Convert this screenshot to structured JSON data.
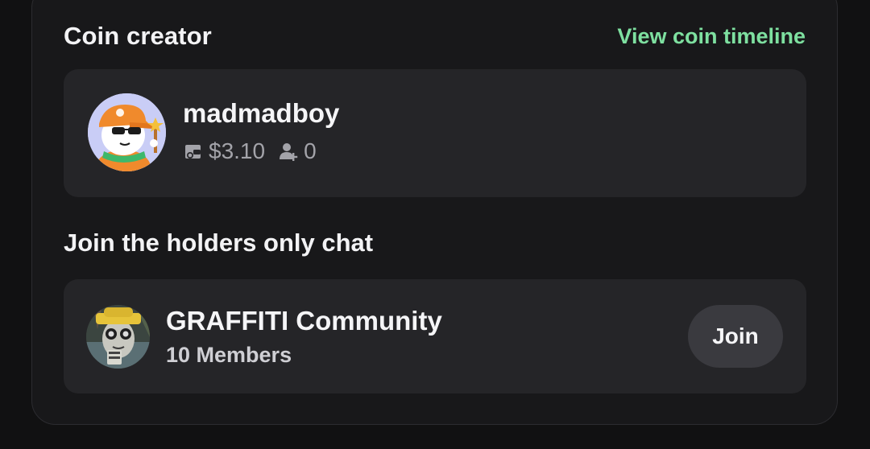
{
  "creator_section": {
    "title": "Coin creator",
    "timeline_link": "View coin timeline"
  },
  "creator": {
    "name": "madmadboy",
    "stats": {
      "value": "$3.10",
      "value_icon": "wallet-icon",
      "followers": "0",
      "followers_icon": "add-user-icon"
    }
  },
  "chat_section": {
    "title": "Join the holders only chat"
  },
  "community": {
    "name": "GRAFFITI Community",
    "members": "10 Members",
    "join_label": "Join"
  },
  "colors": {
    "accent_green": "#7ee0a0",
    "card_bg": "#252528",
    "panel_bg": "#18181a"
  }
}
